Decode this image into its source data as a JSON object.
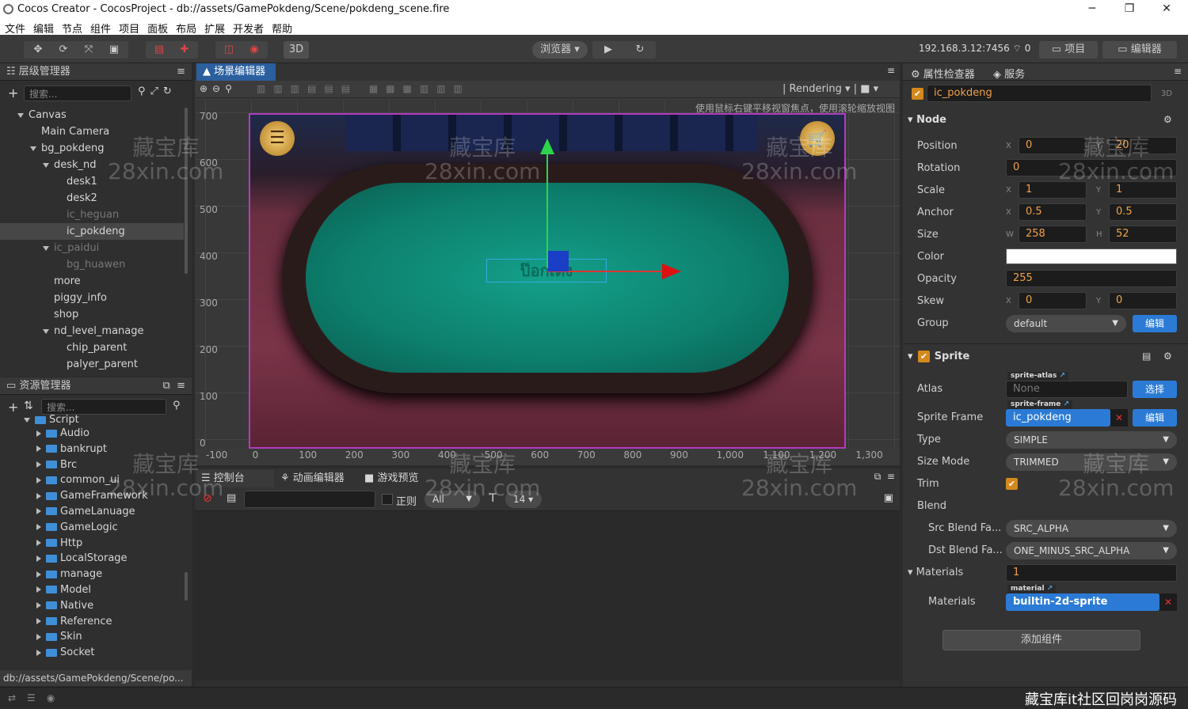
{
  "window": {
    "title": "Cocos Creator - CocosProject - db://assets/GamePokdeng/Scene/pokdeng_scene.fire",
    "minimize": "─",
    "maximize": "❐",
    "close": "✕"
  },
  "menu": [
    "文件",
    "编辑",
    "节点",
    "组件",
    "项目",
    "面板",
    "布局",
    "扩展",
    "开发者",
    "帮助"
  ],
  "toolbar": {
    "mode3d": "3D",
    "browser": "浏览器",
    "ip": "192.168.3.12:7456",
    "count": "0",
    "project": "项目",
    "editor": "编辑器"
  },
  "hierarchy": {
    "title": "层级管理器",
    "search_placeholder": "搜索...",
    "nodes": [
      {
        "label": "Canvas",
        "state": "open"
      },
      {
        "label": "Main Camera",
        "state": "leaf"
      },
      {
        "label": "bg_pokdeng",
        "state": "open"
      },
      {
        "label": "desk_nd",
        "state": "open"
      },
      {
        "label": "desk1",
        "state": "leaf"
      },
      {
        "label": "desk2",
        "state": "leaf"
      },
      {
        "label": "ic_heguan",
        "state": "leaf",
        "dim": true
      },
      {
        "label": "ic_pokdeng",
        "state": "leaf",
        "selected": true
      },
      {
        "label": "ic_paidui",
        "state": "open",
        "dim": true
      },
      {
        "label": "bg_huawen",
        "state": "leaf",
        "dim": true
      },
      {
        "label": "more",
        "state": "leaf"
      },
      {
        "label": "piggy_info",
        "state": "leaf"
      },
      {
        "label": "shop",
        "state": "leaf"
      },
      {
        "label": "nd_level_manage",
        "state": "open"
      },
      {
        "label": "chip_parent",
        "state": "leaf"
      },
      {
        "label": "palyer_parent",
        "state": "leaf"
      }
    ]
  },
  "assets": {
    "title": "资源管理器",
    "search_placeholder": "搜索...",
    "root": "Script",
    "folders": [
      "Audio",
      "bankrupt",
      "Brc",
      "common_ui",
      "GameFramework",
      "GameLanuage",
      "GameLogic",
      "Http",
      "LocalStorage",
      "manage",
      "Model",
      "Native",
      "Reference",
      "Skin",
      "Socket"
    ],
    "path": "db://assets/GamePokdeng/Scene/po..."
  },
  "scene": {
    "tab": "场景编辑器",
    "rendering": "Rendering",
    "hint": "使用鼠标右键平移视窗焦点，使用滚轮缩放视图",
    "y_ticks": [
      "700",
      "600",
      "500",
      "400",
      "300",
      "200",
      "100",
      "0"
    ],
    "x_ticks": [
      "-100",
      "0",
      "100",
      "200",
      "300",
      "400",
      "500",
      "600",
      "700",
      "800",
      "900",
      "1,000",
      "1,100",
      "1,200",
      "1,300"
    ],
    "selected_label": "ป๊อกเด้ง"
  },
  "console": {
    "tabs": [
      "控制台",
      "动画编辑器",
      "游戏预览"
    ],
    "regex_label": "正则",
    "filter_value": "All",
    "font_size": "14"
  },
  "inspector": {
    "tab": "属性检查器",
    "tab2": "服务",
    "node_name": "ic_pokdeng",
    "badge3d": "3D",
    "node_section": "Node",
    "position": {
      "label": "Position",
      "x": "0",
      "y": "20"
    },
    "rotation": {
      "label": "Rotation",
      "value": "0"
    },
    "scale": {
      "label": "Scale",
      "x": "1",
      "y": "1"
    },
    "anchor": {
      "label": "Anchor",
      "x": "0.5",
      "y": "0.5"
    },
    "size": {
      "label": "Size",
      "w": "258",
      "h": "52"
    },
    "color": {
      "label": "Color",
      "value": "#ffffff"
    },
    "opacity": {
      "label": "Opacity",
      "value": "255"
    },
    "skew": {
      "label": "Skew",
      "x": "0",
      "y": "0"
    },
    "group": {
      "label": "Group",
      "value": "default",
      "button": "编辑"
    },
    "axis": {
      "x": "X",
      "y": "Y",
      "w": "W",
      "h": "H"
    },
    "sprite_section": "Sprite",
    "atlas": {
      "label": "Atlas",
      "tag": "sprite-atlas",
      "value": "None",
      "button": "选择"
    },
    "sprite_frame": {
      "label": "Sprite Frame",
      "tag": "sprite-frame",
      "value": "ic_pokdeng",
      "button": "编辑"
    },
    "type": {
      "label": "Type",
      "value": "SIMPLE"
    },
    "size_mode": {
      "label": "Size Mode",
      "value": "TRIMMED"
    },
    "trim": {
      "label": "Trim"
    },
    "blend": {
      "label": "Blend"
    },
    "src_blend": {
      "label": "Src Blend Fa...",
      "value": "SRC_ALPHA"
    },
    "dst_blend": {
      "label": "Dst Blend Fa...",
      "value": "ONE_MINUS_SRC_ALPHA"
    },
    "materials_count": {
      "label": "Materials",
      "value": "1"
    },
    "materials": {
      "label": "Materials",
      "tag": "material",
      "value": "builtin-2d-sprite"
    },
    "add_component": "添加组件"
  },
  "watermark": {
    "line1": "藏宝库",
    "line2": "28xin.com",
    "footer": "藏宝库it社区回岗岗源码"
  },
  "colors": {
    "accent": "#2b7bd6",
    "orange": "#d4891c",
    "felt": "#0f7f6c"
  }
}
